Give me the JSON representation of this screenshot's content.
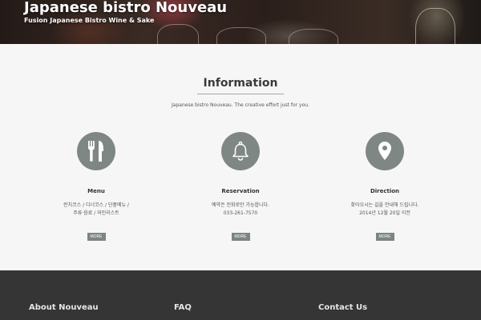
{
  "header": {
    "title": "Japanese bistro Nouveau",
    "subtitle": "Fusion Japanese Bistro Wine & Sake"
  },
  "info": {
    "title": "Information",
    "description": "Japanese bistro Nouveau. The creative effort just for you.",
    "columns": [
      {
        "icon": "utensils-icon",
        "title": "Menu",
        "line1": "런치코스 / 디너코스 / 단품메뉴 /",
        "line2": "주류·음료 / 와인리스트",
        "more": "MORE"
      },
      {
        "icon": "bell-icon",
        "title": "Reservation",
        "line1": "예약은 전화로만 가능합니다.",
        "line2": "033-261-7570",
        "more": "MORE"
      },
      {
        "icon": "map-pin-icon",
        "title": "Direction",
        "line1": "찾아오시는 길을 안내해 드립니다.",
        "line2": "2014년 12월 20일 이전",
        "more": "MORE"
      }
    ]
  },
  "footer": {
    "headings": [
      "About Nouveau",
      "FAQ",
      "Contact Us"
    ]
  },
  "colors": {
    "icon_circle": "#7f8784",
    "footer_bg": "#353535",
    "page_bg": "#f6f6f6"
  }
}
